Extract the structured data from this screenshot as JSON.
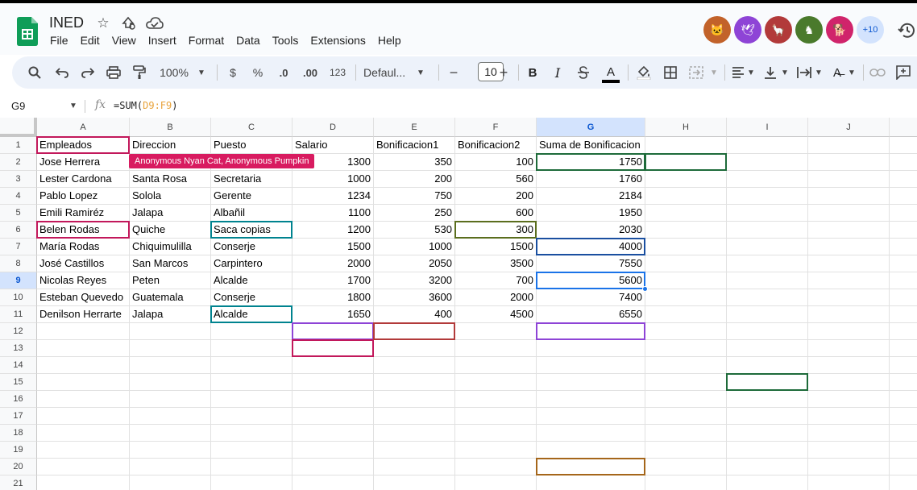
{
  "app": {
    "title": "INED",
    "menus": [
      "File",
      "Edit",
      "View",
      "Insert",
      "Format",
      "Data",
      "Tools",
      "Extensions",
      "Help"
    ],
    "more_collaborators": "+10",
    "collaborators": [
      {
        "icon": "nyan-cat-icon",
        "color": "#c2622a"
      },
      {
        "icon": "bird-icon",
        "color": "#8e44d6"
      },
      {
        "icon": "llama-icon",
        "color": "#b23a3a"
      },
      {
        "icon": "horse-icon",
        "color": "#4a7a2c"
      },
      {
        "icon": "dog-icon",
        "color": "#d0246b"
      }
    ]
  },
  "toolbar": {
    "zoom": "100%",
    "currency": "$",
    "percent": "%",
    "decrease_decimal": ".0",
    "increase_decimal": ".00",
    "number_format": "123",
    "font": "Defaul...",
    "font_size": "10",
    "bold": "B",
    "italic": "I",
    "text_color": "A"
  },
  "formula_bar": {
    "cell_ref": "G9",
    "fx": "fx",
    "formula_prefix": "=SUM(",
    "formula_range": "D9:F9",
    "formula_suffix": ")"
  },
  "sheet": {
    "columns": [
      "A",
      "B",
      "C",
      "D",
      "E",
      "F",
      "G",
      "H",
      "I",
      "J"
    ],
    "active_column": "G",
    "active_row": 9,
    "row_numbers": [
      "1",
      "2",
      "3",
      "4",
      "5",
      "6",
      "7",
      "8",
      "9",
      "10",
      "11",
      "12",
      "13",
      "14",
      "15",
      "16",
      "17",
      "18",
      "19",
      "20",
      "21"
    ],
    "header_row": [
      "Empleados",
      "Direccion",
      "Puesto",
      "Salario",
      "Bonificacion1",
      "Bonificacion2",
      "Suma de Bonificacion"
    ],
    "rows": [
      [
        "Jose Herrera",
        "",
        "",
        "1300",
        "350",
        "100",
        "1750"
      ],
      [
        "Lester Cardona",
        "Santa Rosa",
        "Secretaria",
        "1000",
        "200",
        "560",
        "1760"
      ],
      [
        "Pablo Lopez",
        "Solola",
        "Gerente",
        "1234",
        "750",
        "200",
        "2184"
      ],
      [
        "Emili Ramiréz",
        "Jalapa",
        "Albañil",
        "1100",
        "250",
        "600",
        "1950"
      ],
      [
        "Belen Rodas",
        "Quiche",
        "Saca copias",
        "1200",
        "530",
        "300",
        "2030"
      ],
      [
        "María Rodas",
        "Chiquimulilla",
        "Conserje",
        "1500",
        "1000",
        "1500",
        "4000"
      ],
      [
        "José Castillos",
        "San Marcos",
        "Carpintero",
        "2000",
        "2050",
        "3500",
        "7550"
      ],
      [
        "Nicolas Reyes",
        "Peten",
        "Alcalde",
        "1700",
        "3200",
        "700",
        "5600"
      ],
      [
        "Esteban Quevedo",
        "Guatemala",
        "Conserje",
        "1800",
        "3600",
        "2000",
        "7400"
      ],
      [
        "Denilson Herrarte",
        "Jalapa",
        "Alcalde",
        "1650",
        "400",
        "4500",
        "6550"
      ]
    ],
    "collab_tag": "Anonymous Nyan Cat, Anonymous Pumpkin"
  }
}
